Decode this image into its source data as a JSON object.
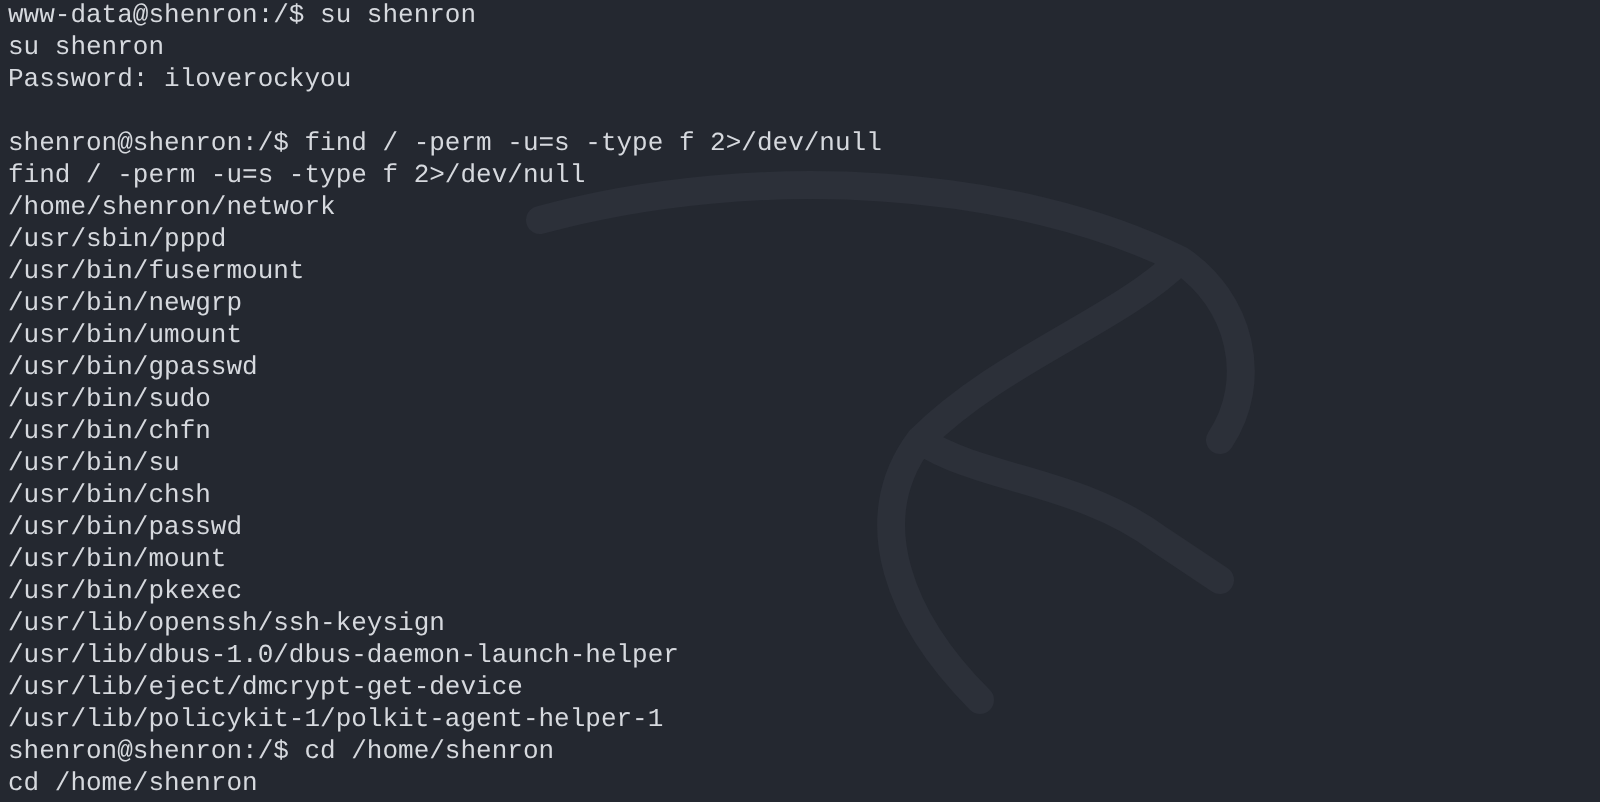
{
  "terminal": {
    "lines": [
      {
        "kind": "text",
        "text": "www-data@shenron:/$ su shenron"
      },
      {
        "kind": "text",
        "text": "su shenron"
      },
      {
        "kind": "text",
        "text": "Password: iloverockyou"
      },
      {
        "kind": "blank"
      },
      {
        "kind": "text",
        "text": "shenron@shenron:/$ find / -perm -u=s -type f 2>/dev/null"
      },
      {
        "kind": "text",
        "text": "find / -perm -u=s -type f 2>/dev/null"
      },
      {
        "kind": "text",
        "text": "/home/shenron/network"
      },
      {
        "kind": "text",
        "text": "/usr/sbin/pppd"
      },
      {
        "kind": "text",
        "text": "/usr/bin/fusermount"
      },
      {
        "kind": "text",
        "text": "/usr/bin/newgrp"
      },
      {
        "kind": "text",
        "text": "/usr/bin/umount"
      },
      {
        "kind": "text",
        "text": "/usr/bin/gpasswd"
      },
      {
        "kind": "text",
        "text": "/usr/bin/sudo"
      },
      {
        "kind": "text",
        "text": "/usr/bin/chfn"
      },
      {
        "kind": "text",
        "text": "/usr/bin/su"
      },
      {
        "kind": "text",
        "text": "/usr/bin/chsh"
      },
      {
        "kind": "text",
        "text": "/usr/bin/passwd"
      },
      {
        "kind": "text",
        "text": "/usr/bin/mount"
      },
      {
        "kind": "text",
        "text": "/usr/bin/pkexec"
      },
      {
        "kind": "text",
        "text": "/usr/lib/openssh/ssh-keysign"
      },
      {
        "kind": "text",
        "text": "/usr/lib/dbus-1.0/dbus-daemon-launch-helper"
      },
      {
        "kind": "text",
        "text": "/usr/lib/eject/dmcrypt-get-device"
      },
      {
        "kind": "text",
        "text": "/usr/lib/policykit-1/polkit-agent-helper-1"
      },
      {
        "kind": "text",
        "text": "shenron@shenron:/$ cd /home/shenron"
      },
      {
        "kind": "text",
        "text": "cd /home/shenron"
      }
    ]
  }
}
